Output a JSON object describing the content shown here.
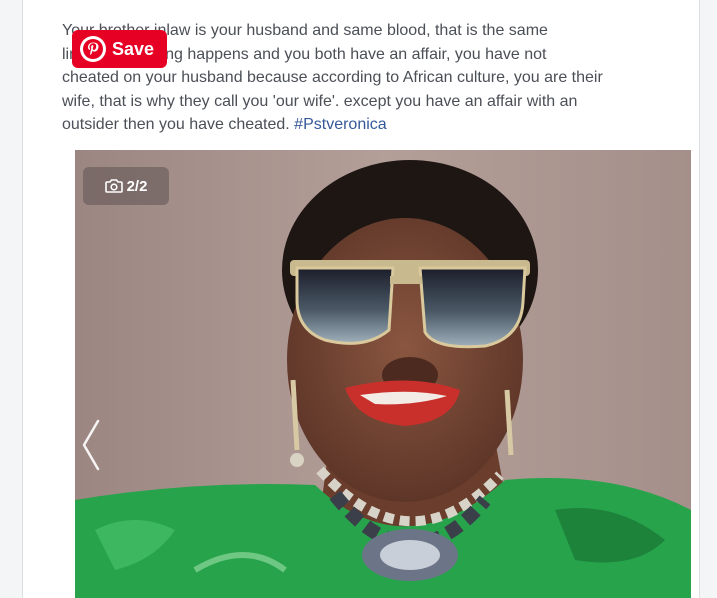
{
  "post": {
    "text_line1": "Your brother inlaw is your husband and same blood, that is the same",
    "text_line2": "line. If something happens and you both have an affair, you have not",
    "text_line3": "cheated on your husband because according to African culture, you are their",
    "text_line4": "wife, that is why they call you 'our wife'. except you have an affair with an",
    "text_line5_prefix": "outsider then you have cheated. ",
    "hashtag": "#Pstveronica"
  },
  "pinterest": {
    "save_label": "Save",
    "icon": "pinterest-icon",
    "color": "#e60023"
  },
  "gallery": {
    "counter": "2/2",
    "camera_icon": "camera-icon",
    "prev_icon": "chevron-left-icon"
  },
  "colors": {
    "hashtag": "#365899",
    "text": "#4b4f56"
  }
}
